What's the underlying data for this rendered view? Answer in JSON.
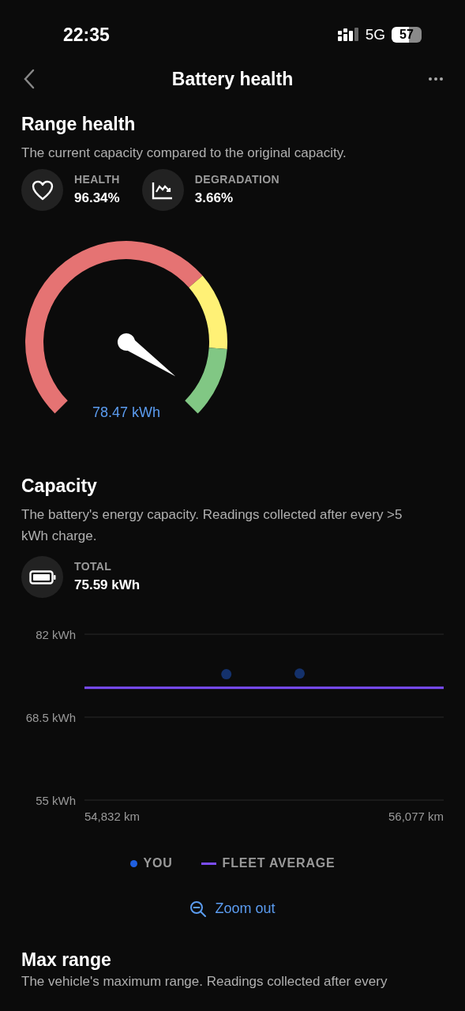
{
  "status_bar": {
    "time": "22:35",
    "network": "5G",
    "battery": "57"
  },
  "header": {
    "title": "Battery health"
  },
  "range_health": {
    "title": "Range health",
    "description": "The current capacity compared to the original capacity.",
    "stats": [
      {
        "kind": "health",
        "label": "HEALTH",
        "value": "96.34%"
      },
      {
        "kind": "degradation",
        "label": "DEGRADATION",
        "value": "3.66%"
      }
    ],
    "gauge": {
      "reading": "78.47 kWh"
    }
  },
  "capacity": {
    "title": "Capacity",
    "description": "The battery's energy capacity. Readings collected after every >5 kWh charge.",
    "total": {
      "label": "TOTAL",
      "value": "75.59 kWh"
    },
    "chart_data": {
      "type": "scatter",
      "x": [
        55300,
        55600
      ],
      "xlim": [
        54719,
        56190
      ],
      "ylim": [
        55,
        82
      ],
      "xticks": [
        {
          "value": 54832,
          "label": "54,832 km"
        },
        {
          "value": 56077,
          "label": "56,077 km"
        }
      ],
      "yticks": [
        {
          "value": 82,
          "label": "82 kWh"
        },
        {
          "value": 68.5,
          "label": "68.5 kWh"
        },
        {
          "value": 55,
          "label": "55 kWh"
        }
      ],
      "series": [
        {
          "name": "YOU",
          "color": "#1f5fe0",
          "values": [
            75.5,
            75.6
          ]
        }
      ],
      "ref_lines": [
        {
          "axis": "y",
          "value": 73.3,
          "label": "FLEET AVERAGE",
          "color": "#7c4dff"
        }
      ]
    },
    "zoom_button": "Zoom out"
  },
  "max_range": {
    "title": "Max range",
    "description": "The vehicle's maximum range. Readings collected after every"
  }
}
